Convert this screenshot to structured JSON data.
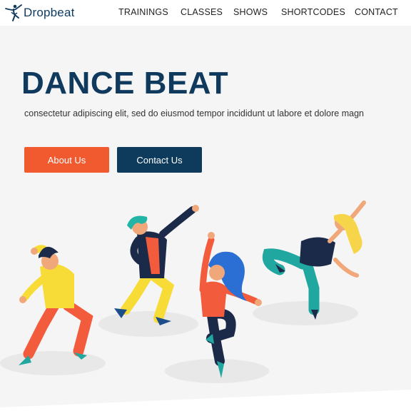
{
  "brand": {
    "name": "Dropbeat"
  },
  "nav": {
    "items": [
      {
        "label": "TRAININGS"
      },
      {
        "label": "CLASSES"
      },
      {
        "label": "SHOWS"
      },
      {
        "label": "SHORTCODES"
      },
      {
        "label": "CONTACT"
      }
    ]
  },
  "hero": {
    "title": "DANCE BEAT",
    "subtitle": "consectetur adipiscing elit, sed do eiusmod tempor incididunt ut labore et dolore magn",
    "buttons": {
      "about_label": "About Us",
      "contact_label": "Contact Us"
    }
  },
  "colors": {
    "brand_navy": "#0f3a5e",
    "accent_orange": "#f15a2f",
    "hero_bg": "#f5f5f5"
  }
}
